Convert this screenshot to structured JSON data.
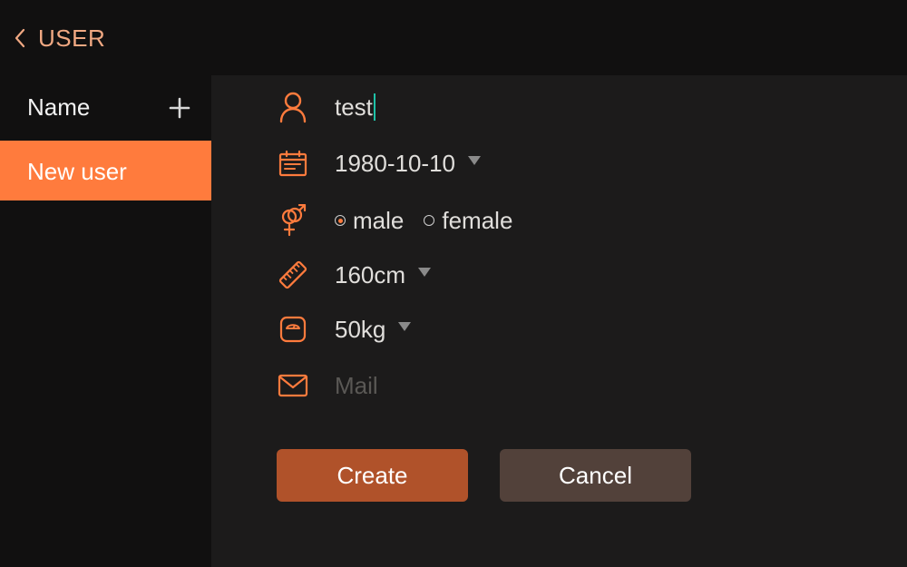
{
  "header": {
    "title": "USER"
  },
  "sidebar": {
    "title": "Name",
    "items": [
      {
        "label": "New user"
      }
    ]
  },
  "form": {
    "name_value": "test",
    "birthday": "1980-10-10",
    "gender": {
      "options": [
        "male",
        "female"
      ],
      "selected": "male"
    },
    "height": "160cm",
    "weight": "50kg",
    "mail_placeholder": "Mail",
    "mail_value": ""
  },
  "actions": {
    "create_label": "Create",
    "cancel_label": "Cancel"
  },
  "icons": {
    "back": "chevron-left-icon",
    "add": "plus-icon",
    "name": "person-icon",
    "birthday": "calendar-icon",
    "gender": "gender-icon",
    "height": "ruler-icon",
    "weight": "scale-icon",
    "mail": "envelope-icon"
  },
  "colors": {
    "accent": "#ff7b3d",
    "header_text": "#f0a882",
    "create_button": "#b0522a",
    "cancel_button": "#52413a",
    "caret": "#1fc2a7"
  }
}
